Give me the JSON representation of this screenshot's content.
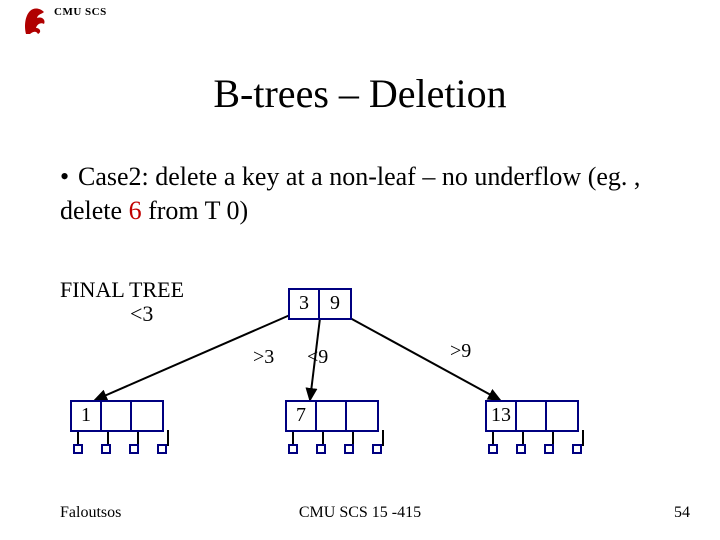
{
  "header": {
    "org": "CMU SCS"
  },
  "title": "B-trees – Deletion",
  "bullet": {
    "pre": "Case2: delete a key at a non-leaf – no underflow (eg. , delete ",
    "highlight": "6",
    "post": " from T 0)"
  },
  "final": {
    "label": "FINAL TREE",
    "lt3": "<3"
  },
  "edges": {
    "gt3": ">3",
    "lt9": "<9",
    "gt9": ">9"
  },
  "root": {
    "k1": "3",
    "k2": "9"
  },
  "leaves": {
    "left": "1",
    "mid": "7",
    "right": "13"
  },
  "footer": {
    "left": "Faloutsos",
    "center": "CMU SCS 15 -415",
    "right": "54"
  }
}
